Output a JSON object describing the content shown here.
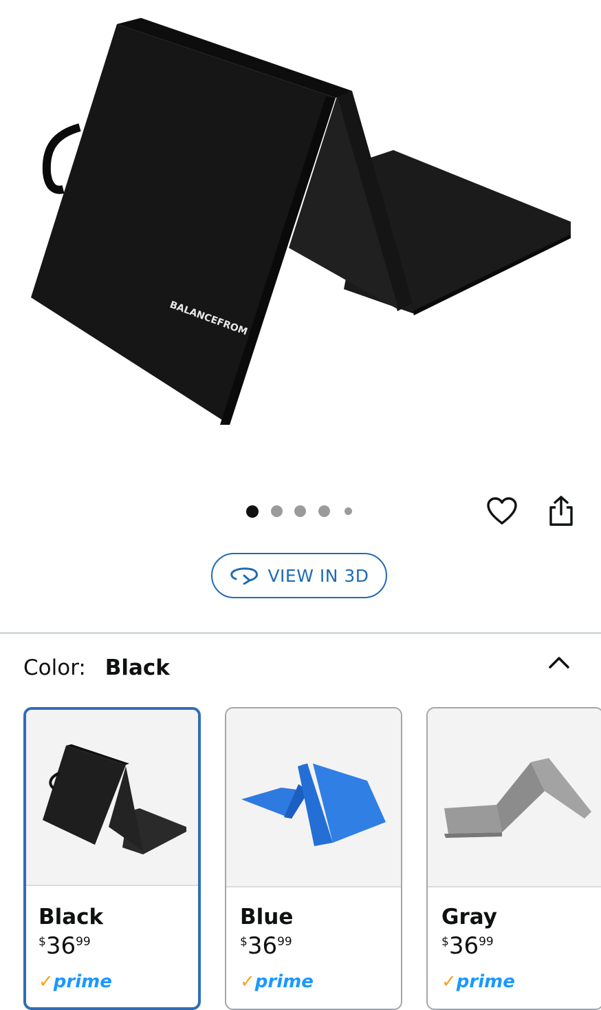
{
  "gallery": {
    "image_alt": "Black tri-fold exercise mat",
    "brand_print": "BALANCEFROM",
    "dot_count": 5,
    "active_index": 0
  },
  "actions": {
    "favorite_icon": "heart-icon",
    "share_icon": "share-icon"
  },
  "view3d": {
    "icon": "rotate-3d-icon",
    "label": "VIEW IN 3D"
  },
  "color": {
    "label": "Color:",
    "selected": "Black",
    "toggle_icon": "chevron-up-icon"
  },
  "swatches": [
    {
      "name": "Black",
      "price_currency": "$",
      "price_whole": "36",
      "price_fraction": "99",
      "badge": "prime",
      "color": "#1c1c1c",
      "selected": true
    },
    {
      "name": "Blue",
      "price_currency": "$",
      "price_whole": "36",
      "price_fraction": "99",
      "badge": "prime",
      "color": "#1f66d6",
      "selected": false
    },
    {
      "name": "Gray",
      "price_currency": "$",
      "price_whole": "36",
      "price_fraction": "99",
      "badge": "prime",
      "color": "#8e8e8e",
      "selected": false
    }
  ],
  "colors": {
    "accent_blue": "#1f6bb5",
    "prime_blue": "#1a98ff",
    "prime_check": "#f4a323"
  }
}
